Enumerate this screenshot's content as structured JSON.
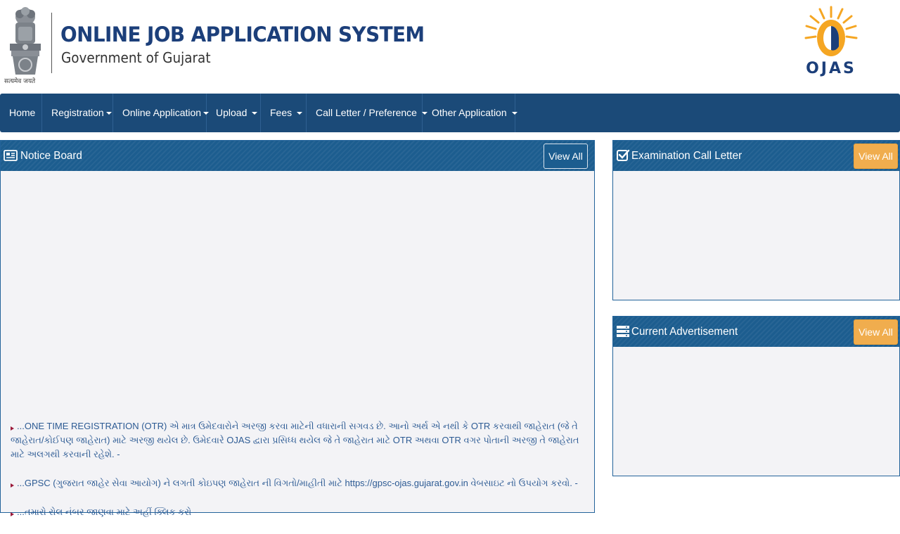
{
  "header": {
    "title": "ONLINE JOB APPLICATION SYSTEM",
    "subtitle": "Government of Gujarat",
    "emblem_caption": "सत्यमेव जयते",
    "logo_text": "OJAS"
  },
  "nav": {
    "items": [
      {
        "label": "Home",
        "dropdown": false
      },
      {
        "label": "Registration",
        "dropdown": true
      },
      {
        "label": "Online Application",
        "dropdown": true
      },
      {
        "label": "Upload",
        "dropdown": true
      },
      {
        "label": "Fees",
        "dropdown": true
      },
      {
        "label": "Call Letter / Preference",
        "dropdown": true
      },
      {
        "label": "Other Application",
        "dropdown": true
      }
    ]
  },
  "notice_board": {
    "title": "Notice Board",
    "view_all": "View All",
    "icon": "newspaper-icon",
    "items": [
      "...ONE TIME REGISTRATION (OTR) એ માત્ર ઉમેદવારોને અરજી કરવા માટેની વધારાની સગવડ છે. આનો અર્થ એ નથી કે OTR કરવાથી જાહેરાત (જે તે જાહેરાત/કોઈપણ જાહેરાત) માટે અરજી થયેલ છે. ઉમેદવારે OJAS દ્વારા પ્રસિધ્ધ થયેલ જે તે જાહેરાત માટે OTR અથવા OTR વગર પોતાની અરજી તે જાહેરાત માટે અલગથી કરવાની રહેશે. -",
      "...GPSC (ગુજરાત જાહેર સેવા આયોગ) ને લગતી કોઇપણ જાહેરાત ની વિગતો/માહીતી માટે https://gpsc-ojas.gujarat.gov.in વેબસાઇટ નો ઉપયોગ કરવો. -",
      "...તમારો રોલ નંબર જાણવા માટે અહીં ક્લિક કરો -"
    ]
  },
  "call_letter": {
    "title": "Examination Call Letter",
    "view_all": "View All",
    "icon": "checkbox-icon"
  },
  "advertisement": {
    "title": "Current Advertisement",
    "view_all": "View All",
    "icon": "server-list-icon"
  },
  "colors": {
    "navbar": "#1b4a78",
    "panel_header": "#1c5d8f",
    "title_blue": "#1c3f7a",
    "orange_button": "#f0ad4e",
    "notice_text": "#2d5b94"
  }
}
